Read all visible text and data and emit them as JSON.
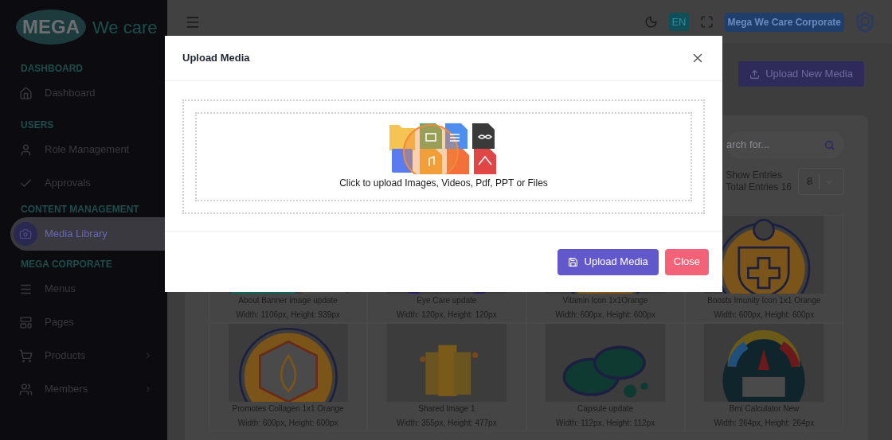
{
  "sidebar": {
    "logo": {
      "brand": "MEGA",
      "tagline": "We care"
    },
    "sections": [
      {
        "title": "DASHBOARD",
        "items": [
          {
            "label": "Dashboard",
            "selected": false,
            "expandable": false
          }
        ]
      },
      {
        "title": "USERS",
        "items": [
          {
            "label": "Role Management",
            "selected": false,
            "expandable": false
          },
          {
            "label": "Approvals",
            "selected": false,
            "expandable": false
          }
        ]
      },
      {
        "title": "CONTENT MANAGEMENT",
        "items": [
          {
            "label": "Media Library",
            "selected": true,
            "expandable": false
          }
        ]
      },
      {
        "title": "MEGA CORPORATE",
        "items": [
          {
            "label": "Menus",
            "selected": false,
            "expandable": false
          },
          {
            "label": "Pages",
            "selected": false,
            "expandable": false
          },
          {
            "label": "Products",
            "selected": false,
            "expandable": true
          },
          {
            "label": "Members",
            "selected": false,
            "expandable": true
          }
        ]
      }
    ]
  },
  "header": {
    "language": "EN",
    "user": "Mega We Care Corporate"
  },
  "page": {
    "upload_button": "Upload New Media",
    "search": {
      "placeholder": "arch for..."
    },
    "entries": {
      "label": "Show Entries",
      "total": "Total Entries 16",
      "page_size": "8"
    },
    "media": [
      {
        "title": "About Banner image update",
        "size": "Width: 1106px, Height: 939px",
        "kind": "picture"
      },
      {
        "title": "Eye Care update",
        "size": "Width: 120px, Height: 120px",
        "kind": "picture"
      },
      {
        "title": "Vitamin Icon 1x1Orange",
        "size": "Width: 600px, Height: 600px",
        "kind": "picture"
      },
      {
        "title": "Boosts Imunity Icon 1x1 Orange",
        "size": "Width: 600px, Height: 600px",
        "kind": "picture"
      },
      {
        "title": "Promotes Collagen 1x1 Orange",
        "size": "Width: 600px, Height: 600px",
        "kind": "picture"
      },
      {
        "title": "Shared Image 1",
        "size": "Width: 355px, Height: 477px",
        "kind": "picture"
      },
      {
        "title": "Capsule update",
        "size": "Width: 112px, Height: 112px",
        "kind": "picture"
      },
      {
        "title": "Bmi Calculator New",
        "size": "Width: 264px, Height: 264px",
        "kind": "picture"
      }
    ]
  },
  "modal": {
    "title": "Upload Media",
    "dropzone_text": "Click to upload Images, Videos, Pdf, PPT or Files",
    "buttons": [
      {
        "label": "Upload Media",
        "kind": "primary"
      },
      {
        "label": "Close",
        "kind": "danger"
      }
    ]
  }
}
